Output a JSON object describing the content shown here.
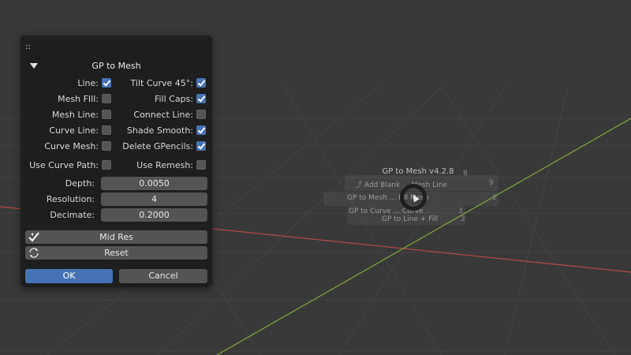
{
  "dialog": {
    "drag_handle": "::",
    "title": "GP to Mesh",
    "left_options": [
      {
        "label": "Line:",
        "checked": true
      },
      {
        "label": "Mesh FIll:",
        "checked": false
      },
      {
        "label": "Mesh Line:",
        "checked": false
      },
      {
        "label": "Curve Line:",
        "checked": false
      },
      {
        "label": "Curve Mesh:",
        "checked": false
      },
      {
        "label": "Use Curve Path:",
        "checked": false
      }
    ],
    "right_options": [
      {
        "label": "Tilt Curve 45°:",
        "checked": true
      },
      {
        "label": "Fill Caps:",
        "checked": true
      },
      {
        "label": "Connect Line:",
        "checked": false
      },
      {
        "label": "Shade Smooth:",
        "checked": true
      },
      {
        "label": "Delete GPencils:",
        "checked": true
      },
      {
        "label": "Use Remesh:",
        "checked": false
      }
    ],
    "fields": [
      {
        "label": "Depth:",
        "value": "0.0050"
      },
      {
        "label": "Resolution:",
        "value": "4"
      },
      {
        "label": "Decimate:",
        "value": "0.2000"
      }
    ],
    "preset_button": {
      "label": "Mid Res",
      "icon": "preset-checkmark-icon"
    },
    "reset_button": {
      "label": "Reset",
      "icon": "reset-refresh-icon"
    },
    "ok_button": "OK",
    "cancel_button": "Cancel"
  },
  "pie_menu": {
    "title": "GP to Mesh v4.2.8",
    "title_key": "8",
    "items": [
      {
        "label": "Add Blank ... Mesh Line",
        "key": "9"
      },
      {
        "label": "GP to Mesh ... Fill Mesh",
        "key": "2"
      },
      {
        "label": "GP to Curve ... Curve",
        "key": "3"
      },
      {
        "label": "GP to Line + Fill",
        "key": "2"
      }
    ]
  },
  "colors": {
    "viewport_bg": "#393939",
    "grid_line": "#434343",
    "x_axis": "#b04848",
    "y_axis": "#7ea23a",
    "dialog_bg": "#1e1e1e",
    "widget_bg": "#545454",
    "accent": "#4772b3"
  }
}
